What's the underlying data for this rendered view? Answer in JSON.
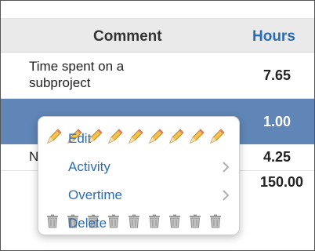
{
  "table": {
    "headers": {
      "comment": "Comment",
      "hours": "Hours"
    },
    "rows": [
      {
        "comment": "Time spent on a subproject",
        "hours": "7.65"
      },
      {
        "comment": "",
        "hours": "1.00"
      },
      {
        "comment": "N",
        "hours": "4.25"
      }
    ],
    "total": "150.00"
  },
  "context_menu": {
    "items": [
      {
        "label": "Edit",
        "icon": "pencil-icon"
      },
      {
        "label": "Activity",
        "icon": "chevron-right-icon"
      },
      {
        "label": "Overtime",
        "icon": "chevron-right-icon"
      },
      {
        "label": "Delete",
        "icon": "trash-icon"
      }
    ]
  },
  "colors": {
    "accent": "#2a6db5",
    "selected_row": "#5f86b7",
    "header_bg": "#eaeaea"
  }
}
